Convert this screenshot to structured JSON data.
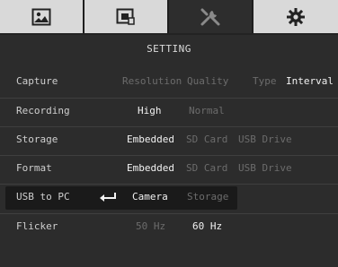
{
  "tabs": [
    {
      "icon": "image-icon"
    },
    {
      "icon": "video-file-icon"
    },
    {
      "icon": "tools-icon"
    },
    {
      "icon": "gear-icon"
    }
  ],
  "title": "SETTING",
  "rows": {
    "capture": {
      "label": "Capture",
      "options": [
        "Resolution",
        "Quality",
        "Type",
        "Interval"
      ]
    },
    "recording": {
      "label": "Recording",
      "options": [
        "High",
        "Normal"
      ]
    },
    "storage": {
      "label": "Storage",
      "options": [
        "Embedded",
        "SD Card",
        "USB Drive"
      ]
    },
    "format": {
      "label": "Format",
      "options": [
        "Embedded",
        "SD Card",
        "USB Drive"
      ]
    },
    "usb_to_pc": {
      "label": "USB to PC",
      "options": [
        "Camera",
        "Storage"
      ]
    },
    "flicker": {
      "label": "Flicker",
      "options": [
        "50 Hz",
        "60 Hz"
      ]
    }
  }
}
